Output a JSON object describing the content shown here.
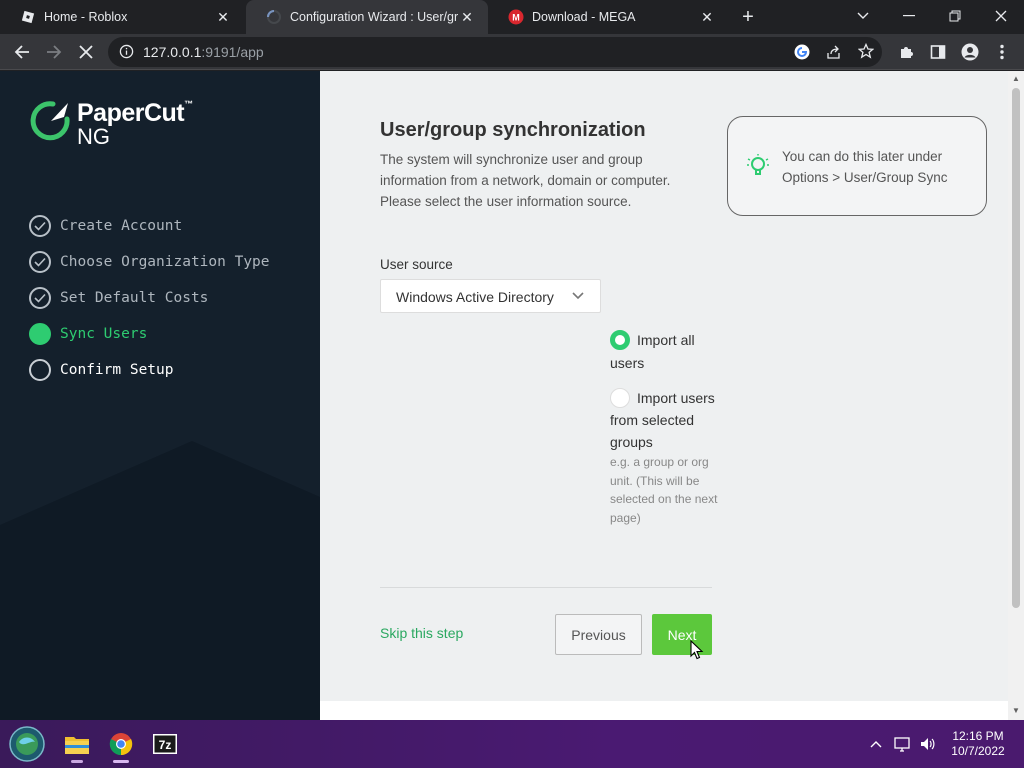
{
  "browser": {
    "tabs": [
      {
        "title": "Home - Roblox",
        "active": false
      },
      {
        "title": "Configuration Wizard : User/group synchronization",
        "active": true
      },
      {
        "title": "Download - MEGA",
        "active": false
      }
    ],
    "url_host": "127.0.0.1",
    "url_rest": ":9191/app"
  },
  "sidebar": {
    "brand": "PaperCut",
    "brand_tm": "™",
    "brand_sub": "NG",
    "steps": [
      {
        "label": "Create Account",
        "state": "done"
      },
      {
        "label": "Choose Organization Type",
        "state": "done"
      },
      {
        "label": "Set Default Costs",
        "state": "done"
      },
      {
        "label": "Sync Users",
        "state": "current"
      },
      {
        "label": "Confirm Setup",
        "state": "pending"
      }
    ]
  },
  "main": {
    "title": "User/group synchronization",
    "description": "The system will synchronize user and group information from a network, domain or computer. Please select the user information source.",
    "tip": "You can do this later under Options > User/Group Sync",
    "user_source_label": "User source",
    "user_source_value": "Windows Active Directory",
    "options": [
      {
        "label": "Import all users",
        "selected": true
      },
      {
        "label": "Import users from selected groups",
        "selected": false,
        "hint": "e.g. a group or org unit. (This will be selected on the next page)"
      }
    ],
    "skip_label": "Skip this step",
    "previous_label": "Previous",
    "next_label": "Next"
  },
  "taskbar": {
    "time": "12:16 PM",
    "date": "10/7/2022"
  },
  "colors": {
    "accent_green": "#2ecc71",
    "next_button": "#5cc83c",
    "sidebar_bg": "#14202c"
  }
}
